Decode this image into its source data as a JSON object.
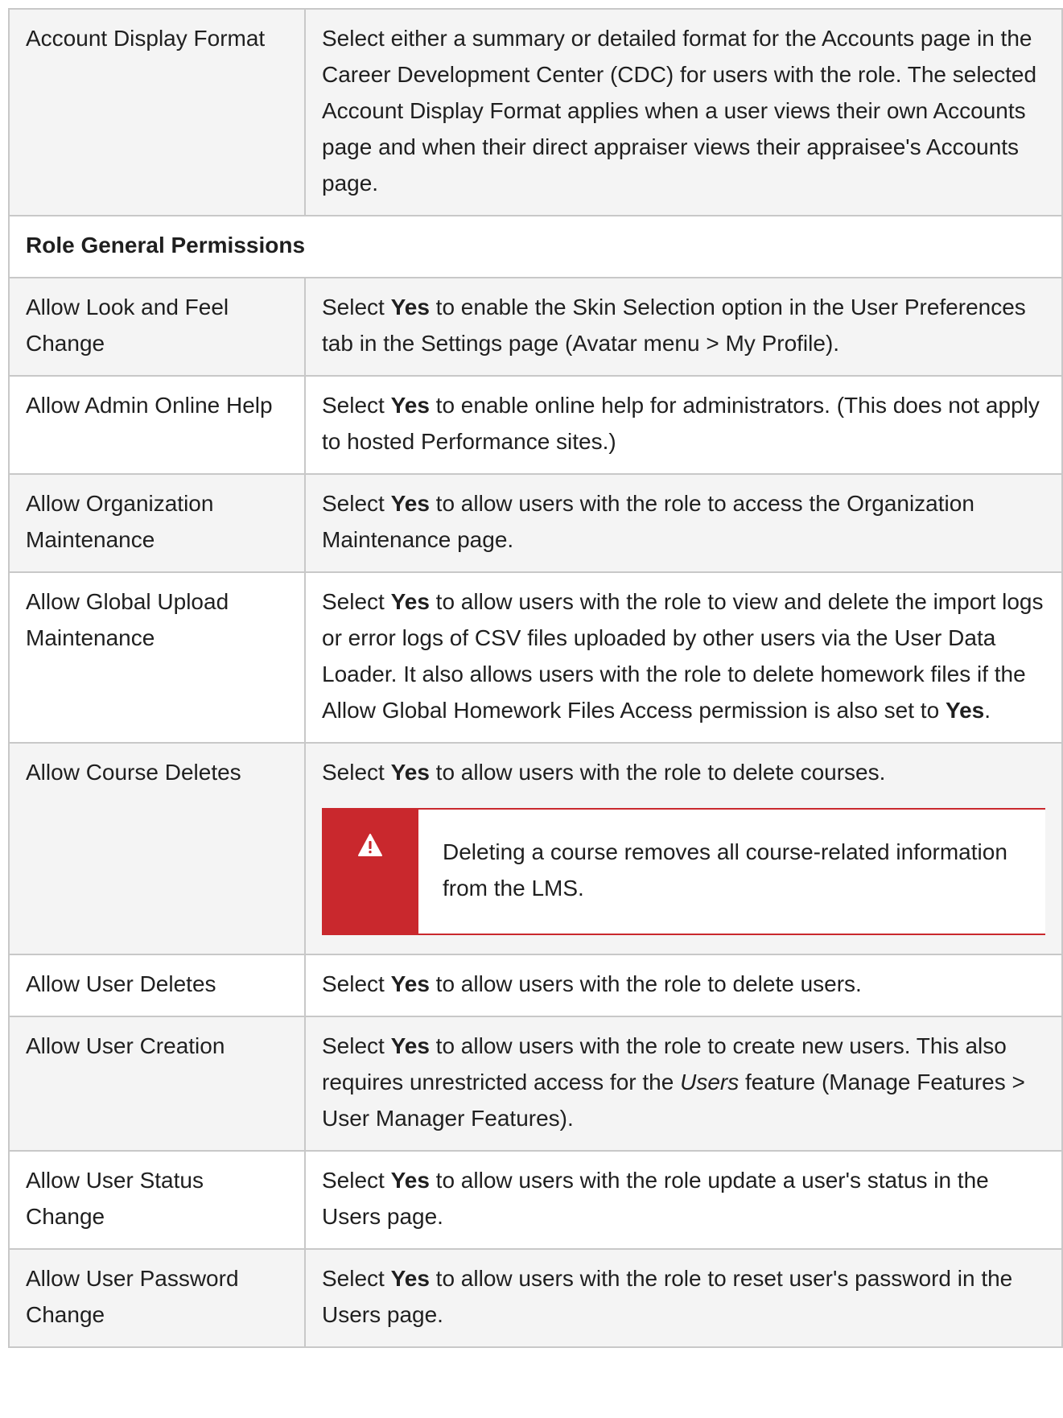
{
  "rows": [
    {
      "type": "row",
      "label": "Account Display Format",
      "desc": [
        {
          "t": "Select either a summary or detailed format for the Accounts page in the Career Development Center (CDC) for users with the role. The selected Account Display Format applies when a user views their own Accounts page and when their direct appraiser views their appraisee's Accounts page."
        }
      ]
    },
    {
      "type": "section",
      "label": "Role General Permissions"
    },
    {
      "type": "row",
      "label": "Allow Look and Feel Change",
      "desc": [
        {
          "t": "Select "
        },
        {
          "t": "Yes",
          "s": "b"
        },
        {
          "t": " to enable the Skin Selection option in the User Preferences tab in the Settings page (Avatar menu > My Profile)."
        }
      ]
    },
    {
      "type": "row",
      "label": "Allow Admin Online Help",
      "desc": [
        {
          "t": "Select "
        },
        {
          "t": "Yes",
          "s": "b"
        },
        {
          "t": " to enable online help for administrators. (This does not apply to hosted Performance sites.)"
        }
      ]
    },
    {
      "type": "row",
      "label": "Allow Organization Maintenance",
      "desc": [
        {
          "t": "Select "
        },
        {
          "t": "Yes",
          "s": "b"
        },
        {
          "t": " to allow users with the role to access the Organization Maintenance page."
        }
      ]
    },
    {
      "type": "row",
      "label": "Allow Global Upload Maintenance",
      "desc": [
        {
          "t": "Select "
        },
        {
          "t": "Yes",
          "s": "b"
        },
        {
          "t": " to allow users with the role to view and delete the import logs or error logs of CSV files uploaded by other users via the User Data Loader. It also allows users with the role to delete homework files if the Allow Global Homework Files Access permission is also set to "
        },
        {
          "t": "Yes",
          "s": "b"
        },
        {
          "t": "."
        }
      ]
    },
    {
      "type": "row",
      "label": "Allow Course Deletes",
      "desc": [
        {
          "t": "Select "
        },
        {
          "t": "Yes",
          "s": "b"
        },
        {
          "t": " to allow users with the role to delete courses."
        }
      ],
      "warning": {
        "icon": "warning-icon",
        "text": "Deleting a course removes all course-related information from the LMS."
      }
    },
    {
      "type": "row",
      "label": "Allow User Deletes",
      "desc": [
        {
          "t": "Select "
        },
        {
          "t": "Yes",
          "s": "b"
        },
        {
          "t": " to allow users with the role to delete users."
        }
      ]
    },
    {
      "type": "row",
      "label": "Allow User Creation",
      "desc": [
        {
          "t": "Select "
        },
        {
          "t": "Yes",
          "s": "b"
        },
        {
          "t": " to allow users with the role to create new users. This also requires unrestricted access for the "
        },
        {
          "t": "Users",
          "s": "i"
        },
        {
          "t": " feature (Manage Features > User Manager Features)."
        }
      ]
    },
    {
      "type": "row",
      "label": "Allow User Status Change",
      "desc": [
        {
          "t": "Select "
        },
        {
          "t": "Yes",
          "s": "b"
        },
        {
          "t": " to allow users with the role update a user's status in the Users page."
        }
      ]
    },
    {
      "type": "row",
      "label": "Allow User Password Change",
      "desc": [
        {
          "t": "Select "
        },
        {
          "t": "Yes",
          "s": "b"
        },
        {
          "t": " to allow users with the role to reset user's password in the Users page."
        }
      ]
    }
  ],
  "colors": {
    "border": "#c8c8c8",
    "row_shade": "#f4f4f4",
    "warning_red": "#c9282d"
  }
}
